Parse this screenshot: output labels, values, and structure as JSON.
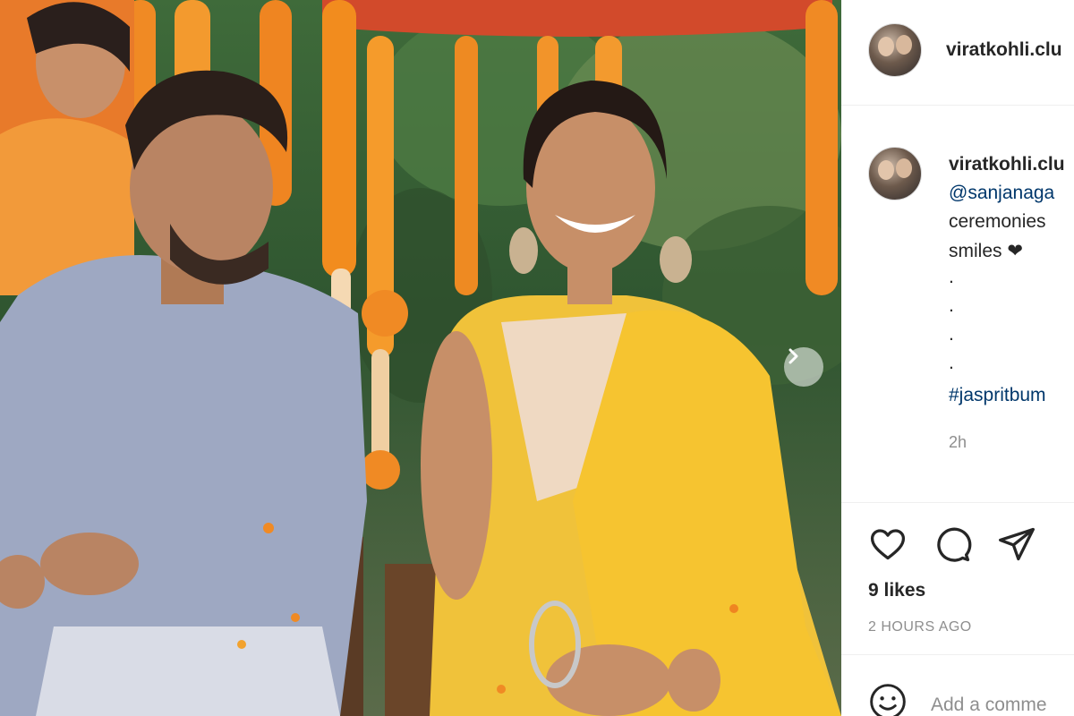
{
  "post": {
    "photo_alt": "",
    "next_icon": "chevron-right-icon"
  },
  "header": {
    "avatar_icon": "profile-avatar",
    "username": "viratkohli.clu"
  },
  "caption": {
    "username": "viratkohli.clu",
    "lines": [
      "@sanjanaga",
      "ceremonies",
      "smiles ❤",
      ".",
      ".",
      ".",
      ".",
      "#jaspritbum"
    ],
    "time": "2h"
  },
  "actions": {
    "like_icon": "heart-icon",
    "comment_icon": "comment-icon",
    "share_icon": "send-icon",
    "likes": "9 likes",
    "posted_ago": "2 HOURS AGO"
  },
  "comment": {
    "emoji_icon": "emoji-icon",
    "placeholder": "Add a comme"
  },
  "colors": {
    "link": "#00376b",
    "muted": "#8e8e8e",
    "border": "#efefef",
    "text": "#262626"
  }
}
